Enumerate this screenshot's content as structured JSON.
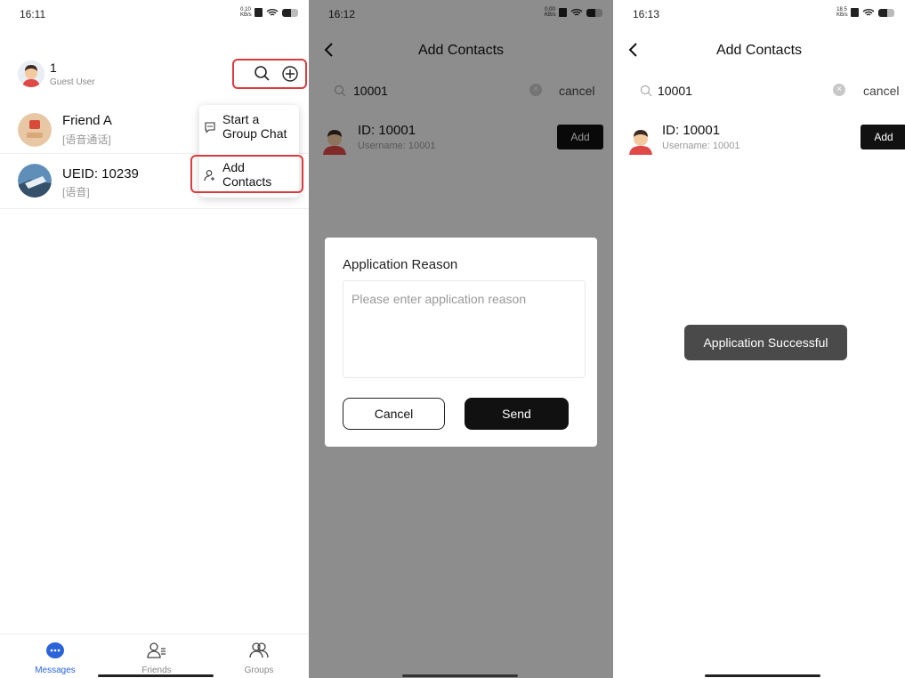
{
  "screen1": {
    "status_time": "16:11",
    "status_speed": "0.10 KB/s",
    "profile": {
      "name": "1",
      "subtitle": "Guest User"
    },
    "header_icons": [
      "search-icon",
      "add-circle-icon"
    ],
    "chats": [
      {
        "name": "Friend A",
        "preview": "[语音通话]"
      },
      {
        "name": "UEID: 10239",
        "preview": "[语音]"
      }
    ],
    "menu": {
      "start_group_chat": "Start a Group Chat",
      "add_contacts": "Add Contacts"
    },
    "tabs": [
      {
        "label": "Messages",
        "active": true
      },
      {
        "label": "Friends",
        "active": false
      },
      {
        "label": "Groups",
        "active": false
      }
    ],
    "highlight_color": "#d93b40",
    "accent_color": "#2b64d8"
  },
  "screen2": {
    "status_time": "16:12",
    "status_speed": "0.00 KB/s",
    "title": "Add Contacts",
    "search_value": "10001",
    "cancel_label": "cancel",
    "result": {
      "id": "ID: 10001",
      "username": "Username: 10001",
      "add_label": "Add"
    },
    "dialog": {
      "title": "Application Reason",
      "placeholder": "Please enter application reason",
      "cancel": "Cancel",
      "send": "Send"
    }
  },
  "screen3": {
    "status_time": "16:13",
    "status_speed": "18.5 KB/s",
    "title": "Add Contacts",
    "search_value": "10001",
    "cancel_label": "cancel",
    "result": {
      "id": "ID: 10001",
      "username": "Username: 10001",
      "add_label": "Add"
    },
    "toast": "Application Successful"
  }
}
